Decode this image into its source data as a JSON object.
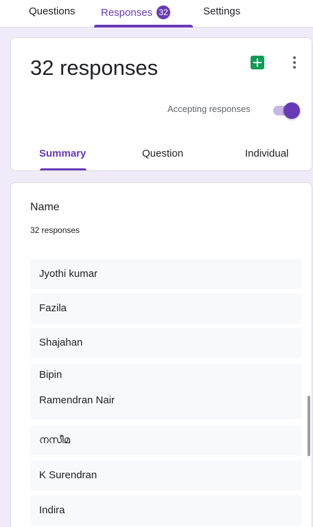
{
  "top_tabs": {
    "questions": "Questions",
    "responses": "Responses",
    "responses_badge": "32",
    "settings": "Settings"
  },
  "header": {
    "title": "32 responses",
    "accepting_label": "Accepting responses",
    "accepting_on": true
  },
  "sub_tabs": {
    "summary": "Summary",
    "question": "Question",
    "individual": "Individual"
  },
  "question": {
    "title": "Name",
    "count": "32 responses",
    "answers": [
      "Jyothi kumar",
      "Fazila",
      "Shajahan",
      "Bipin",
      "Ramendran Nair",
      "നസീമ",
      "K Surendran",
      "Indira"
    ]
  },
  "colors": {
    "accent": "#673ab7",
    "sheets_green": "#0f9d58",
    "background": "#f0ebf8"
  }
}
